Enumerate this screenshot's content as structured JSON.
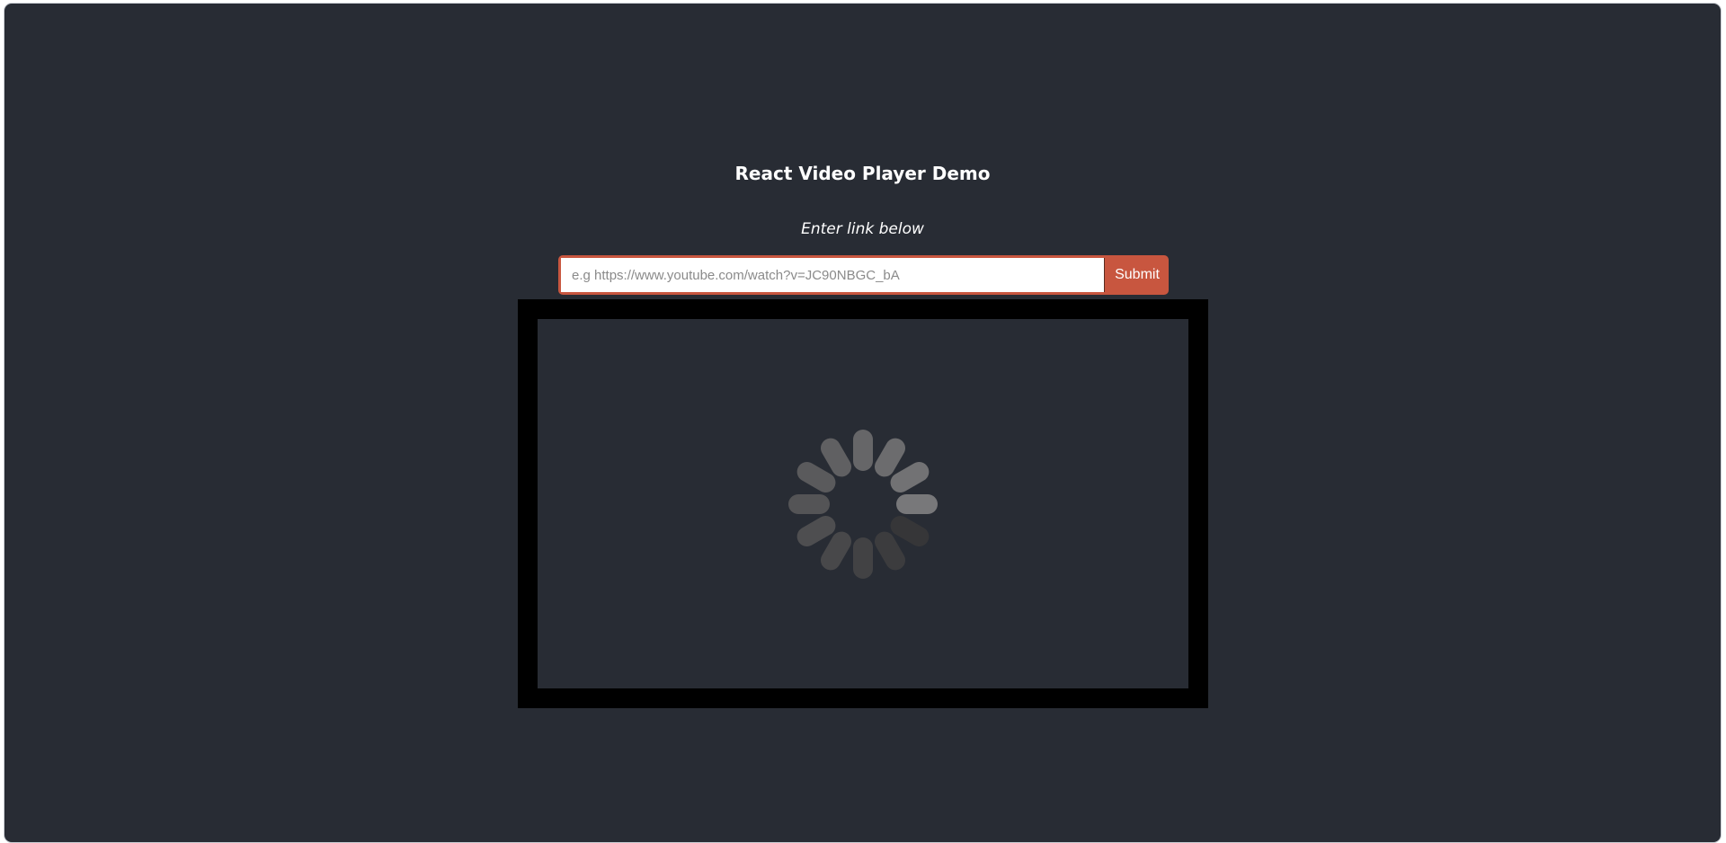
{
  "header": {
    "title": "React Video Player Demo",
    "subtitle": "Enter link below"
  },
  "form": {
    "url_value": "",
    "url_placeholder": "e.g https://www.youtube.com/watch?v=JC90NBGC_bA",
    "submit_label": "Submit"
  },
  "player": {
    "state_icon": "loading-spinner-icon",
    "screen_color": "#282c34",
    "frame_color": "#000000"
  },
  "colors": {
    "background": "#282c34",
    "accent": "#c8563f",
    "text": "#ffffff"
  }
}
